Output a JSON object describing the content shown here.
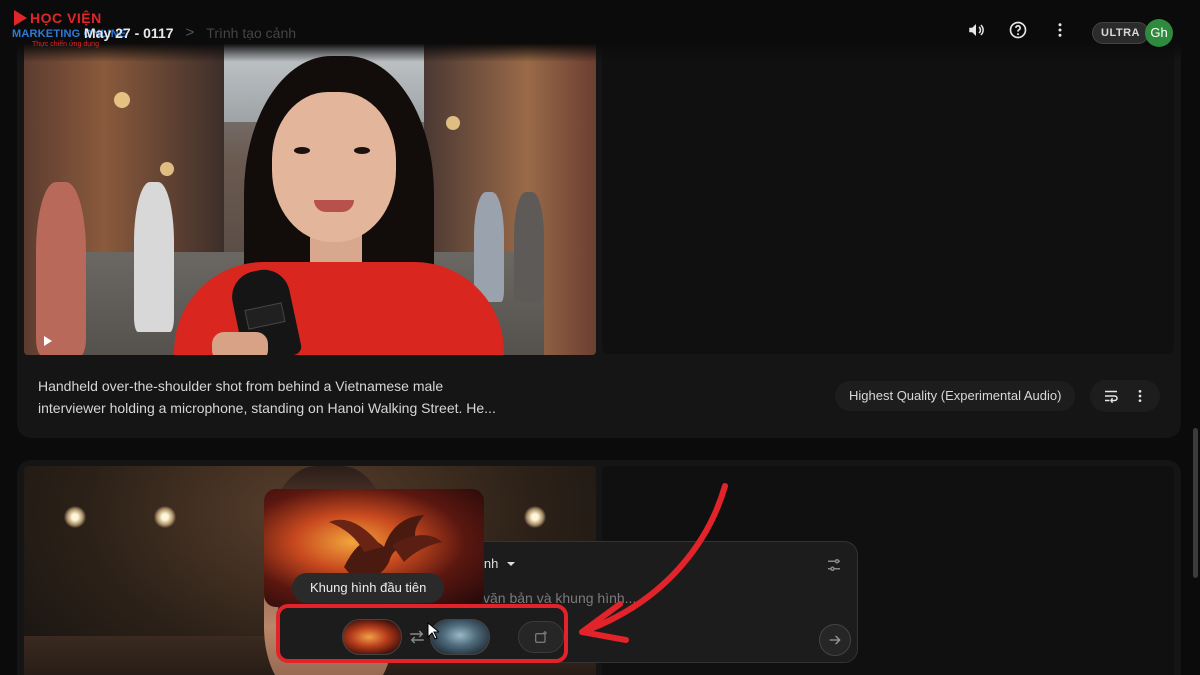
{
  "logo": {
    "line1": "HỌC VIỆN",
    "line2": "MARKETING ONLINE",
    "line3": "Thực chiến ứng dụng"
  },
  "breadcrumb": {
    "project": "May 27 - 0117",
    "separator": ">",
    "page": "Trình tạo cảnh"
  },
  "header": {
    "icons": [
      "volume-icon",
      "help-icon",
      "more-vert-icon"
    ],
    "plan_badge": "ULTRA",
    "avatar_initials": "Gh",
    "avatar_color": "#2e8b3d"
  },
  "clip1": {
    "description_line1": "Handheld over-the-shoulder shot from behind a Vietnamese male",
    "description_line2": "interviewer holding a microphone, standing on Hanoi Walking Street. He...",
    "quality": "Highest Quality (Experimental Audio)"
  },
  "composer": {
    "mode_fragment": "inh",
    "placeholder_fragment": "văn bản và khung hình...",
    "frame_tooltip": "Khung hình đầu tiên"
  },
  "annotation": {
    "color": "#e2232a"
  },
  "colors": {
    "background": "#0b0b0b",
    "card": "#151515",
    "accent_red": "#e2232a"
  }
}
